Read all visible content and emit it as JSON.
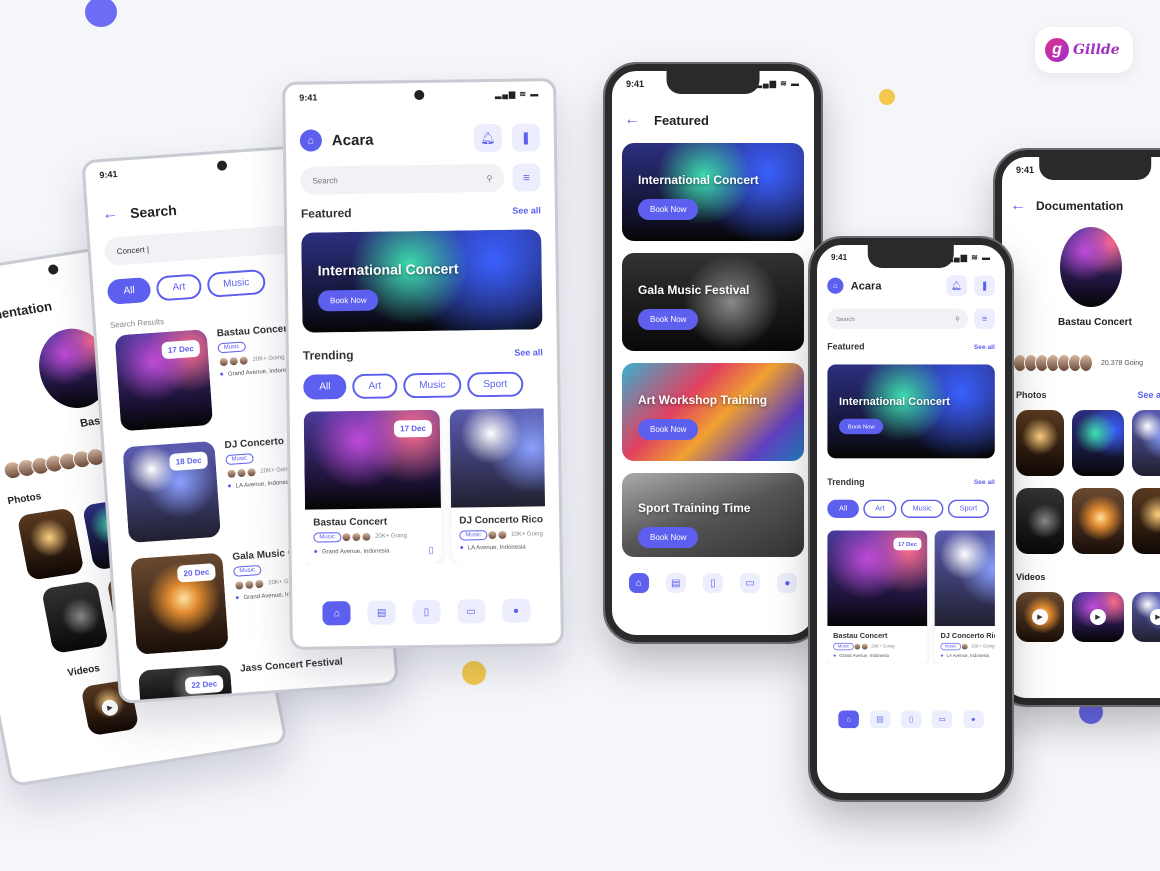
{
  "brand": {
    "name": "Gillde",
    "logo_letter": "g"
  },
  "status": {
    "time": "9:41",
    "signal": "▂▄▆ ≋ ▬"
  },
  "doc_left": {
    "title": "Documentation",
    "event": "Bastau Concert",
    "photos_label": "Photos",
    "videos_label": "Videos"
  },
  "search_screen": {
    "back": "←",
    "title": "Search",
    "query": "Concert |",
    "chips": [
      "All",
      "Art",
      "Music"
    ],
    "results_label": "Search Results",
    "results": [
      {
        "date": "17 Dec",
        "title": "Bastau Concert",
        "tag": "Music",
        "going": "20K+ Going",
        "location": "Grand Avenue, Indonesia"
      },
      {
        "date": "18 Dec",
        "title": "DJ Concerto Rico",
        "tag": "Music",
        "going": "20K+ Going",
        "location": "LA Avenue, Indonesia"
      },
      {
        "date": "20 Dec",
        "title": "Gala Music Concert",
        "tag": "Music",
        "going": "20K+ Going",
        "location": "Grand Avenue, Indonesia"
      },
      {
        "date": "22 Dec",
        "title": "Jass Concert Festival"
      }
    ]
  },
  "home": {
    "app": "Acara",
    "search_placeholder": "Search",
    "featured": "Featured",
    "see_all": "See all",
    "featured_card": {
      "title": "International Concert",
      "button": "Book Now"
    },
    "trending": "Trending",
    "chips": [
      "All",
      "Art",
      "Music",
      "Sport"
    ],
    "events": [
      {
        "date": "17 Dec",
        "title": "Bastau Concert",
        "tag": "Music",
        "going": "20K+ Going",
        "location": "Grand Avenue, Indonesia"
      },
      {
        "date": "18 Dec",
        "title": "DJ Concerto Rico",
        "tag": "Music",
        "going": "10K+ Going",
        "location": "LA Avenue, Indonesia"
      }
    ]
  },
  "featured_screen": {
    "back": "←",
    "title": "Featured",
    "cards": [
      {
        "title": "International Concert",
        "button": "Book Now"
      },
      {
        "title": "Gala Music Festival",
        "button": "Book Now"
      },
      {
        "title": "Art Workshop Training",
        "button": "Book Now"
      },
      {
        "title": "Sport Training Time",
        "button": "Book Now"
      }
    ]
  },
  "doc_right": {
    "back": "←",
    "title": "Documentation",
    "event": "Bastau Concert",
    "going": "20.378 Going",
    "photos_label": "Photos",
    "videos_label": "Videos",
    "see_all": "See all"
  },
  "colors": {
    "accent": "#5d5fef",
    "background": "#f5f6fa",
    "dot_yellow": "#f2c94c"
  }
}
